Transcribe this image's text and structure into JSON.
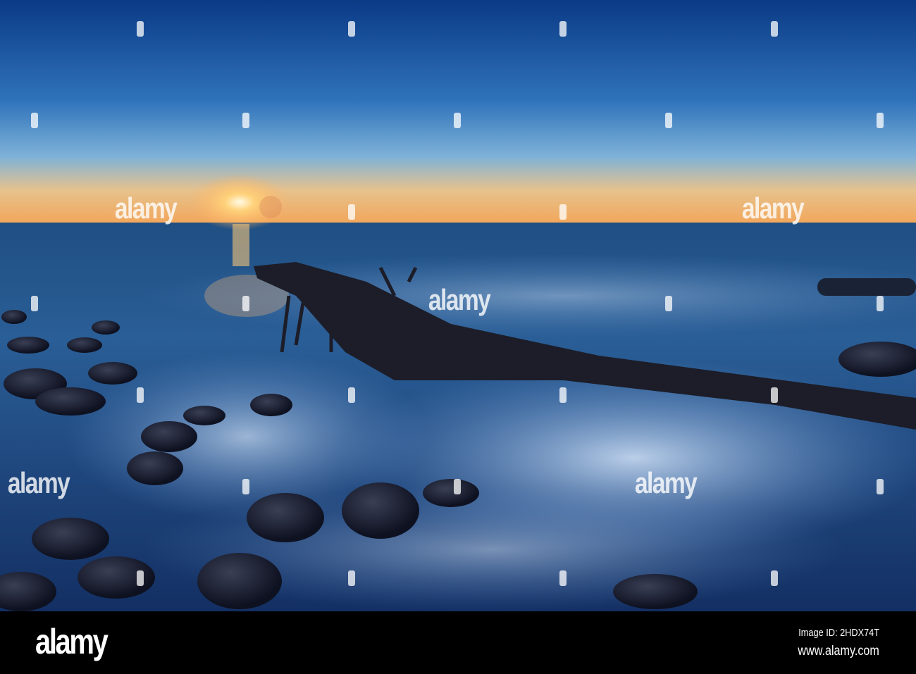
{
  "photo": {
    "subject": "sunset-sea-driftwood",
    "colors": {
      "sky_top": "#0b3a85",
      "sky_mid": "#3f86c8",
      "horizon": "#f2a65a",
      "sea": "#1d4a7e",
      "foam": "#b9d3f0",
      "rock": "#15192a"
    }
  },
  "watermark": {
    "text": "alamy"
  },
  "footer": {
    "logo": "alamy",
    "image_id": "Image ID: 2HDX74T",
    "url": "www.alamy.com"
  }
}
